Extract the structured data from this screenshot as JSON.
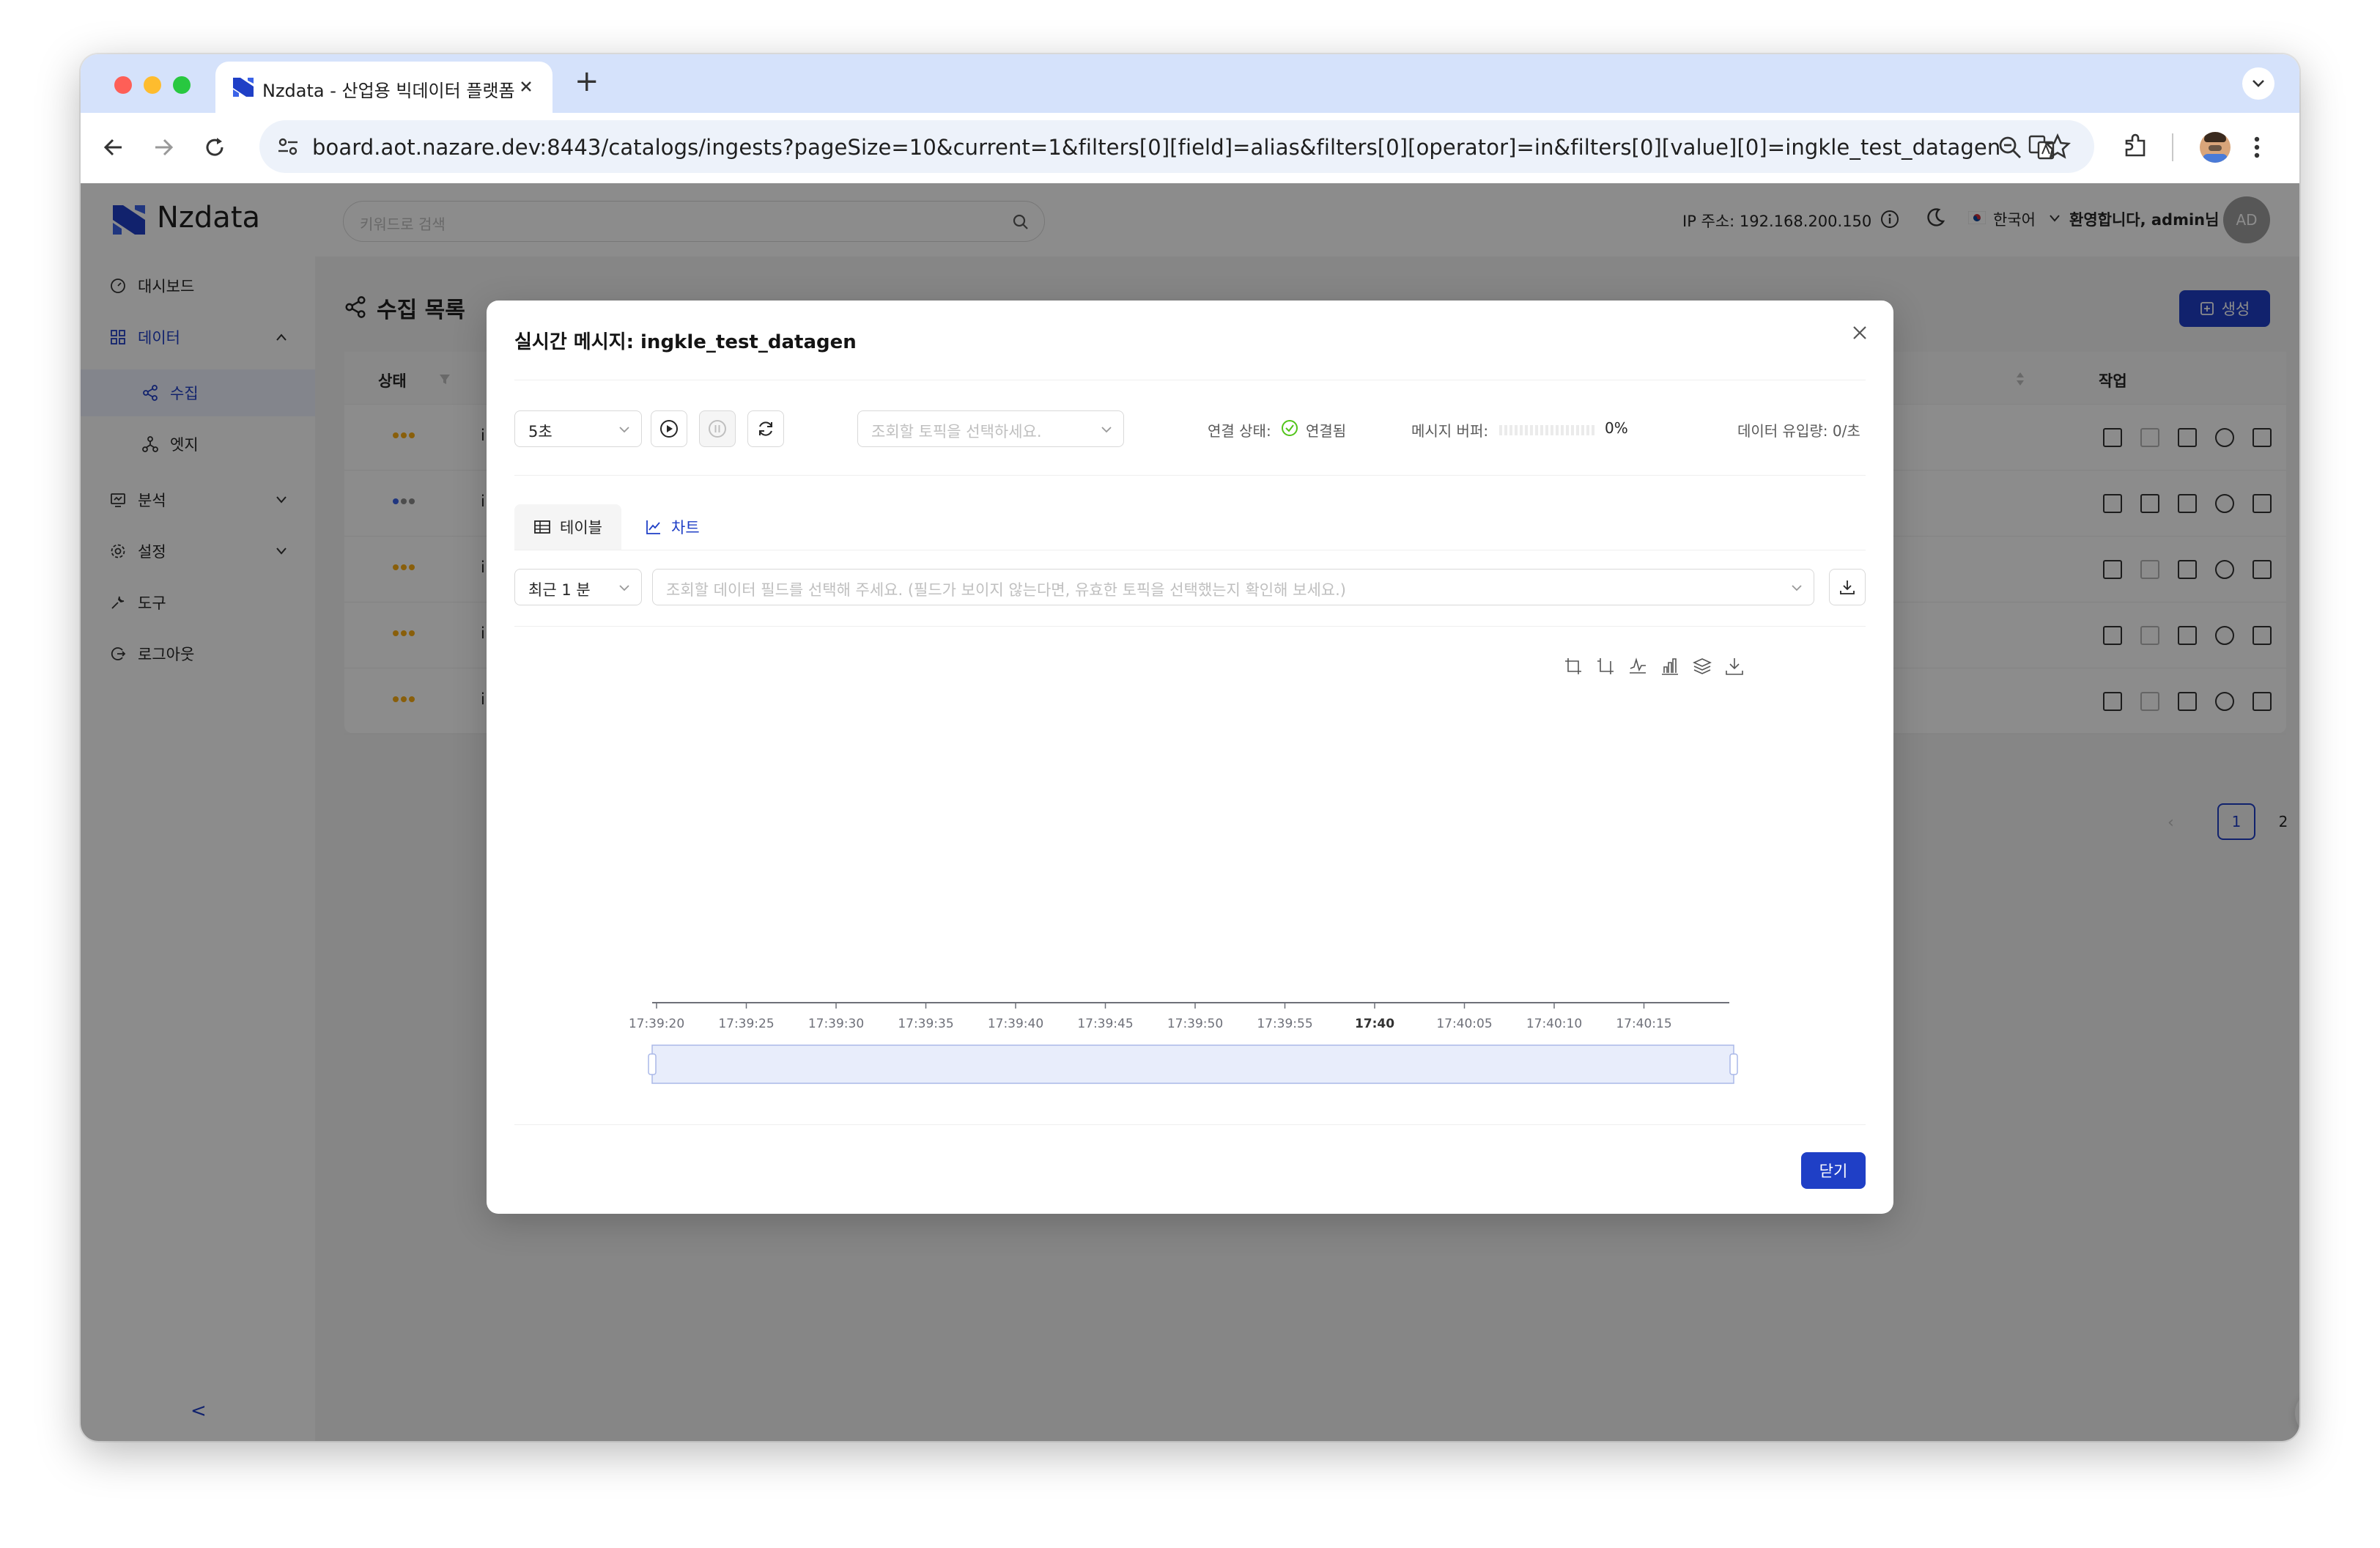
{
  "browser": {
    "tab_title": "Nzdata - 산업용 빅데이터 플랫폼",
    "new_tab_symbol": "+",
    "url": "board.aot.nazare.dev:8443/catalogs/ingests?pageSize=10&current=1&filters[0][field]=alias&filters[0][operator]=in&filters[0][value][0]=ingkle_test_datagen"
  },
  "header": {
    "logo_text": "Nzdata",
    "search_placeholder": "키워드로 검색",
    "ip_label": "IP 주소: 192.168.200.150",
    "language": "한국어",
    "welcome": "환영합니다, admin님",
    "avatar": "AD"
  },
  "sidebar": {
    "items": [
      {
        "label": "대시보드",
        "icon": "dashboard-icon"
      },
      {
        "label": "데이터",
        "icon": "data-icon"
      },
      {
        "label": "수집",
        "icon": "share-icon"
      },
      {
        "label": "엣지",
        "icon": "edge-icon"
      },
      {
        "label": "분석",
        "icon": "analysis-icon"
      },
      {
        "label": "설정",
        "icon": "settings-icon"
      },
      {
        "label": "도구",
        "icon": "tool-icon"
      },
      {
        "label": "로그아웃",
        "icon": "logout-icon"
      }
    ],
    "collapse_symbol": "<"
  },
  "page": {
    "title": "수집 목록",
    "create_button": "생성",
    "columns": {
      "status": "상태",
      "actions": "작업"
    },
    "row_prefix": "i",
    "pagination": {
      "pages": [
        "1",
        "2"
      ],
      "current": "1"
    }
  },
  "modal": {
    "title": "실시간 메시지: ingkle_test_datagen",
    "interval": "5초",
    "topic_placeholder": "조회할 토픽을 선택하세요.",
    "connection_label": "연결 상태:",
    "connection_value": "연결됨",
    "buffer_label": "메시지 버퍼:",
    "buffer_value": "0%",
    "buffer_fill": 0,
    "inflow_label": "데이터 유입량: 0/초",
    "tabs": {
      "table": "테이블",
      "chart": "차트"
    },
    "range": "최근 1 분",
    "field_placeholder": "조회할 데이터 필드를 선택해 주세요. (필드가 보이지 않는다면, 유효한 토픽을 선택했는지 확인해 보세요.)",
    "close_button": "닫기"
  },
  "colors": {
    "primary": "#1f3fc6",
    "success": "#52c41a",
    "warning_dots": "#faad14",
    "zoom_fill": "#e8edfb"
  },
  "chart_data": {
    "type": "line",
    "x": [
      "17:39:20",
      "17:39:25",
      "17:39:30",
      "17:39:35",
      "17:39:40",
      "17:39:45",
      "17:39:50",
      "17:39:55",
      "17:40",
      "17:40:05",
      "17:40:10",
      "17:40:15"
    ],
    "series": [],
    "toolbox": [
      "zoom-icon",
      "zoom-reset-icon",
      "line-type-icon",
      "bar-type-icon",
      "stack-icon",
      "save-image-icon"
    ],
    "data_zoom": [
      0,
      100
    ],
    "grid": false
  }
}
